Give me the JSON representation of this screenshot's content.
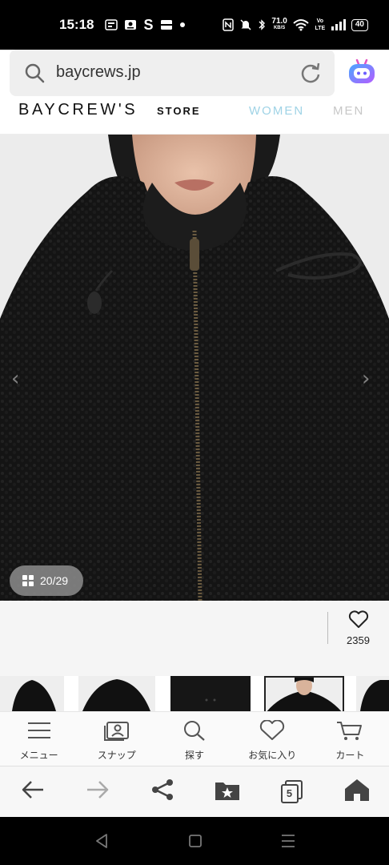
{
  "status_bar": {
    "time": "15:18",
    "network_speed_value": "71.0",
    "network_speed_unit": "KB/S",
    "volte": "Vo LTE",
    "battery": "40"
  },
  "address_bar": {
    "url": "baycrews.jp"
  },
  "site_header": {
    "brand": "BAYCREW'S",
    "store": "STORE",
    "nav_women": "WOMEN",
    "nav_men": "MEN"
  },
  "product_image": {
    "counter_current": "20",
    "counter_separator": "/",
    "counter_total": "29"
  },
  "favorite": {
    "count": "2359"
  },
  "site_nav": {
    "items": [
      {
        "label": "メニュー",
        "icon": "hamburger-icon"
      },
      {
        "label": "スナップ",
        "icon": "snap-icon"
      },
      {
        "label": "探す",
        "icon": "search-icon"
      },
      {
        "label": "お気に入り",
        "icon": "heart-icon"
      },
      {
        "label": "カート",
        "icon": "cart-icon"
      }
    ]
  },
  "browser_bar": {
    "tabs_count": "5"
  },
  "colors": {
    "women_accent": "#9fd3e6",
    "assistant_gradient_start": "#4aa8ff",
    "assistant_gradient_end": "#b45cff"
  }
}
